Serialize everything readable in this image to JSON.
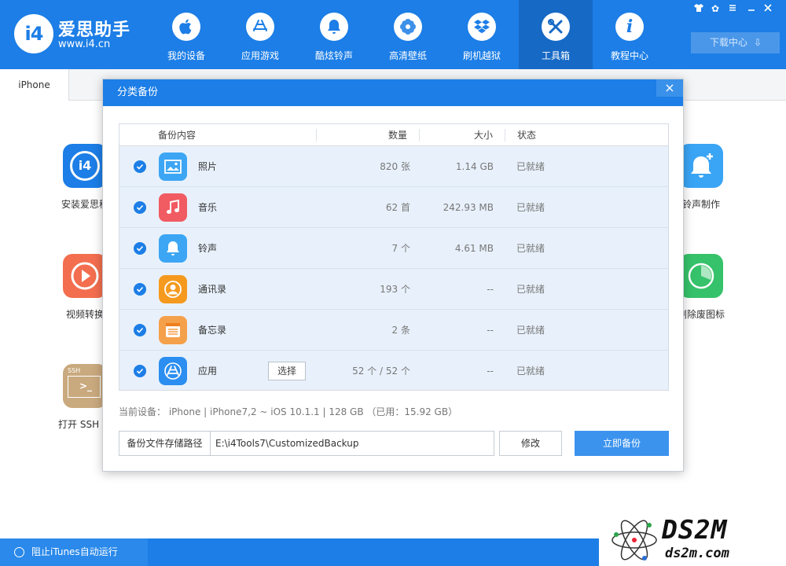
{
  "app": {
    "title": "爱思助手",
    "url": "www.i4.cn",
    "logo_badge": "i4"
  },
  "nav": [
    {
      "label": "我的设备",
      "icon": "apple-icon"
    },
    {
      "label": "应用游戏",
      "icon": "appstore-icon"
    },
    {
      "label": "酷炫铃声",
      "icon": "bell-icon"
    },
    {
      "label": "高清壁纸",
      "icon": "flower-icon"
    },
    {
      "label": "刷机越狱",
      "icon": "dropbox-icon"
    },
    {
      "label": "工具箱",
      "icon": "tools-icon",
      "active": true
    },
    {
      "label": "教程中心",
      "icon": "info-icon"
    }
  ],
  "window_controls": [
    "shirt-icon",
    "gear-icon",
    "minimize-icon",
    "close-icon"
  ],
  "download_center": "下载中心",
  "device_tab": "iPhone",
  "tools_left": [
    {
      "label": "安装爱思移",
      "icon": "i4-icon",
      "color": "#1c7ee6"
    },
    {
      "label": "视频转换",
      "icon": "play-icon",
      "color": "#f36e4f"
    },
    {
      "label": "打开 SSH 通",
      "icon": "ssh-icon",
      "color": "#c9a97e",
      "icon_text": "SSH"
    }
  ],
  "tools_right": [
    {
      "label": "铃声制作",
      "icon": "bell-plus-icon",
      "color": "#3aa5f5"
    },
    {
      "label": "删除废图标",
      "icon": "pie-icon",
      "color": "#36c26a"
    }
  ],
  "status_bar": {
    "itunes_block": "阻止iTunes自动运行"
  },
  "watermark": {
    "text": "DS2M",
    "sub": "ds2m.com"
  },
  "modal": {
    "title": "分类备份",
    "close": "×",
    "headers": {
      "content": "备份内容",
      "count": "数量",
      "size": "大小",
      "status": "状态"
    },
    "rows": [
      {
        "name": "照片",
        "count": "820 张",
        "size": "1.14 GB",
        "status": "已就绪",
        "icon": "photos-icon",
        "color": "#3ca6f4"
      },
      {
        "name": "音乐",
        "count": "62 首",
        "size": "242.93 MB",
        "status": "已就绪",
        "icon": "music-icon",
        "color": "#f15b62"
      },
      {
        "name": "铃声",
        "count": "7 个",
        "size": "4.61 MB",
        "status": "已就绪",
        "icon": "bell-icon",
        "color": "#3ca6f4"
      },
      {
        "name": "通讯录",
        "count": "193 个",
        "size": "--",
        "status": "已就绪",
        "icon": "contacts-icon",
        "color": "#f59a1f"
      },
      {
        "name": "备忘录",
        "count": "2 条",
        "size": "--",
        "status": "已就绪",
        "icon": "notes-icon",
        "color": "#f5a04b"
      },
      {
        "name": "应用",
        "count": "52 个 / 52 个",
        "size": "--",
        "status": "已就绪",
        "icon": "appstore-icon",
        "color": "#2b8ef0",
        "select_label": "选择"
      }
    ],
    "device_info": "当前设备： iPhone  |  iPhone7,2 ~ iOS 10.1.1  |  128 GB （已用：15.92 GB）",
    "path_label": "备份文件存储路径",
    "path_value": "E:\\i4Tools7\\CustomizedBackup",
    "modify": "修改",
    "backup_now": "立即备份"
  }
}
